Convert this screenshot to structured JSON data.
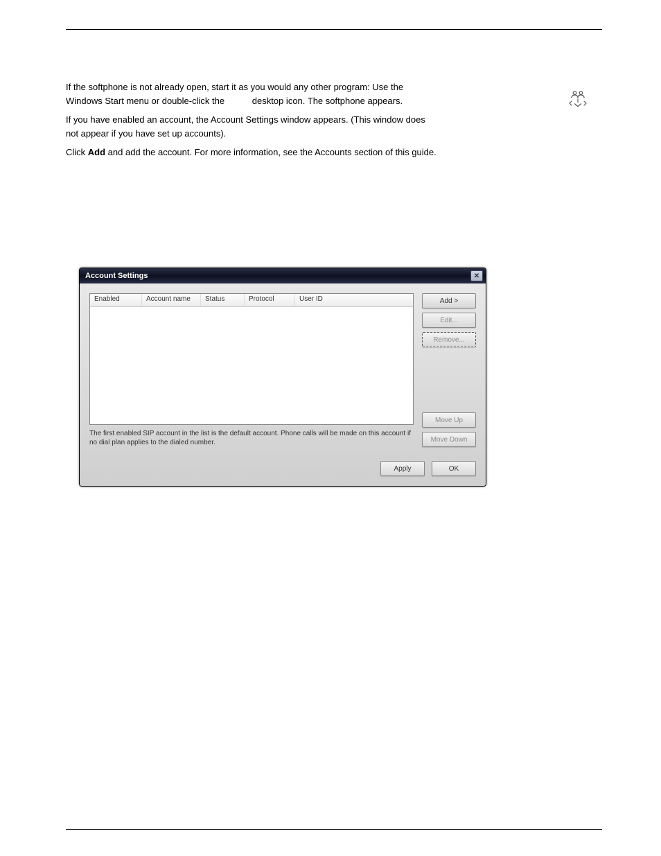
{
  "doc": {
    "intro_line1": "If the softphone is not already open, start it as you would any other program: Use the",
    "intro_line2": "Windows Start menu or double-click the",
    "intro_line3": "desktop icon. The softphone appears.",
    "intro_para2": "If you have enabled an account, the Account Settings window appears. (This window does",
    "intro_para2b": "not appear if you have set up accounts).",
    "intro_para3a": "Click ",
    "intro_para3_add": "Add",
    "intro_para3b": " and add the account. For more information, see the Accounts section of this guide."
  },
  "dialog": {
    "title": "Account Settings",
    "columns": {
      "enabled": "Enabled",
      "account_name": "Account name",
      "status": "Status",
      "protocol": "Protocol",
      "user_id": "User ID"
    },
    "buttons": {
      "add": "Add >",
      "edit": "Edit...",
      "remove": "Remove...",
      "move_up": "Move Up",
      "move_down": "Move Down",
      "apply": "Apply",
      "ok": "OK"
    },
    "desc": "The first enabled SIP account in the list is the default account. Phone calls will be made on this account if no dial plan applies to the dialed number."
  }
}
